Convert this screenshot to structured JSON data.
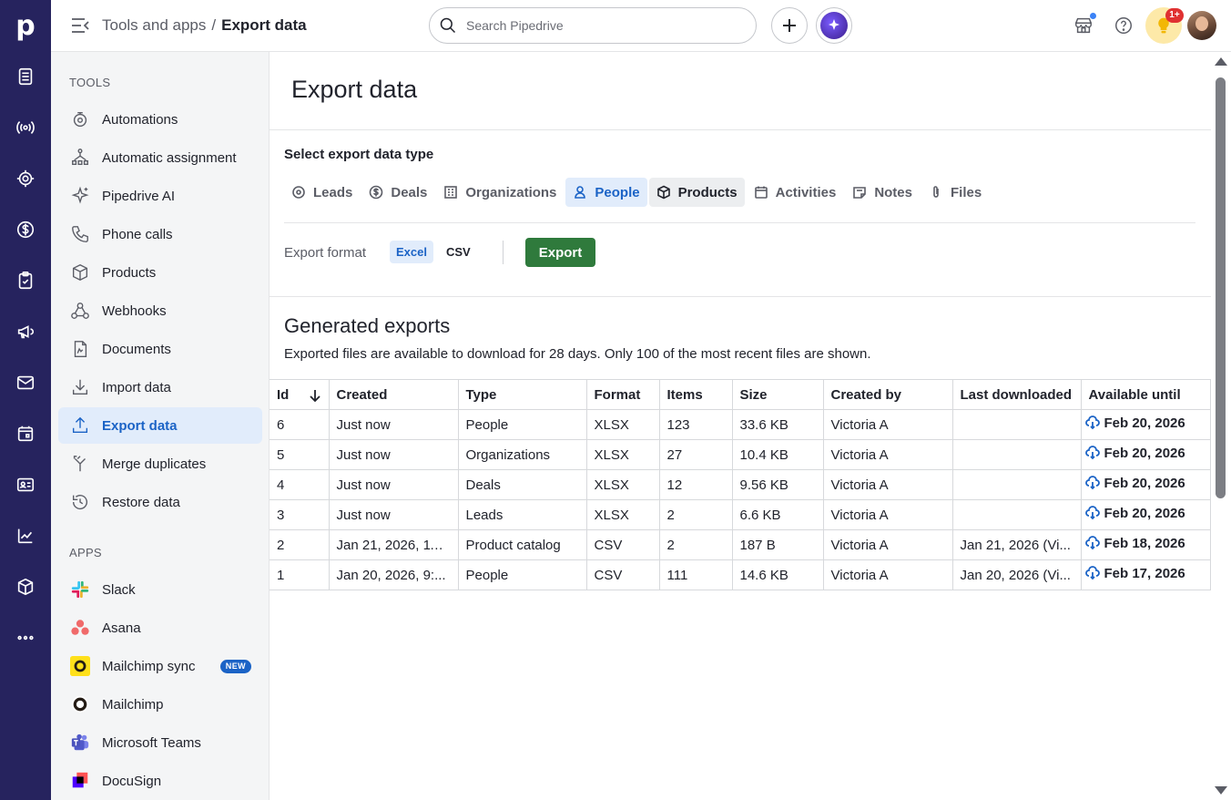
{
  "rail": {
    "logo": "p",
    "items": [
      "deals-list-icon",
      "campaigns-icon",
      "leads-icon",
      "deals-icon",
      "tasks-icon",
      "megaphone-icon",
      "mail-icon",
      "calendar-icon",
      "contacts-card-icon",
      "insights-icon",
      "products-icon",
      "more-icon"
    ]
  },
  "topbar": {
    "breadcrumb_parent": "Tools and apps",
    "breadcrumb_sep": "/",
    "breadcrumb_current": "Export data",
    "search_placeholder": "Search Pipedrive",
    "notif_badge": "1+"
  },
  "sidebar": {
    "tools_header": "TOOLS",
    "tools": [
      {
        "label": "Automations",
        "icon": "automations-icon"
      },
      {
        "label": "Automatic assignment",
        "icon": "assignment-icon"
      },
      {
        "label": "Pipedrive AI",
        "icon": "sparkle-icon"
      },
      {
        "label": "Phone calls",
        "icon": "phone-icon"
      },
      {
        "label": "Products",
        "icon": "box-icon"
      },
      {
        "label": "Webhooks",
        "icon": "webhook-icon"
      },
      {
        "label": "Documents",
        "icon": "document-icon"
      },
      {
        "label": "Import data",
        "icon": "import-icon"
      },
      {
        "label": "Export data",
        "icon": "export-icon"
      },
      {
        "label": "Merge duplicates",
        "icon": "merge-icon"
      },
      {
        "label": "Restore data",
        "icon": "restore-icon"
      }
    ],
    "apps_header": "APPS",
    "apps": [
      {
        "label": "Slack",
        "icon": "slack-icon"
      },
      {
        "label": "Asana",
        "icon": "asana-icon"
      },
      {
        "label": "Mailchimp sync",
        "icon": "mailchimp-icon",
        "badge": "NEW"
      },
      {
        "label": "Mailchimp",
        "icon": "mailchimp-icon"
      },
      {
        "label": "Microsoft Teams",
        "icon": "teams-icon"
      },
      {
        "label": "DocuSign",
        "icon": "docusign-icon"
      }
    ]
  },
  "main": {
    "title": "Export data",
    "select_label": "Select export data type",
    "types": [
      "Leads",
      "Deals",
      "Organizations",
      "People",
      "Products",
      "Activities",
      "Notes",
      "Files"
    ],
    "selected_type": "People",
    "format_label": "Export format",
    "formats": [
      "Excel",
      "CSV"
    ],
    "selected_format": "Excel",
    "export_button": "Export",
    "generated_title": "Generated exports",
    "generated_desc": "Exported files are available to download for 28 days. Only 100 of the most recent files are shown.",
    "columns": [
      "Id",
      "Created",
      "Type",
      "Format",
      "Items",
      "Size",
      "Created by",
      "Last downloaded",
      "Available until"
    ],
    "rows": [
      [
        "6",
        "Just now",
        "People",
        "XLSX",
        "123",
        "33.6 KB",
        "Victoria A",
        "",
        "Feb 20, 2026"
      ],
      [
        "5",
        "Just now",
        "Organizations",
        "XLSX",
        "27",
        "10.4 KB",
        "Victoria A",
        "",
        "Feb 20, 2026"
      ],
      [
        "4",
        "Just now",
        "Deals",
        "XLSX",
        "12",
        "9.56 KB",
        "Victoria A",
        "",
        "Feb 20, 2026"
      ],
      [
        "3",
        "Just now",
        "Leads",
        "XLSX",
        "2",
        "6.6 KB",
        "Victoria A",
        "",
        "Feb 20, 2026"
      ],
      [
        "2",
        "Jan 21, 2026, 11:...",
        "Product catalog",
        "CSV",
        "2",
        "187 B",
        "Victoria A",
        "Jan 21, 2026 (Vi...",
        "Feb 18, 2026"
      ],
      [
        "1",
        "Jan 20, 2026, 9:...",
        "People",
        "CSV",
        "111",
        "14.6 KB",
        "Victoria A",
        "Jan 20, 2026 (Vi...",
        "Feb 17, 2026"
      ]
    ]
  },
  "colors": {
    "rail": "#26235e",
    "accent": "#1b63c6",
    "export_button": "#2f7a3c",
    "badge_red": "#e03131"
  }
}
